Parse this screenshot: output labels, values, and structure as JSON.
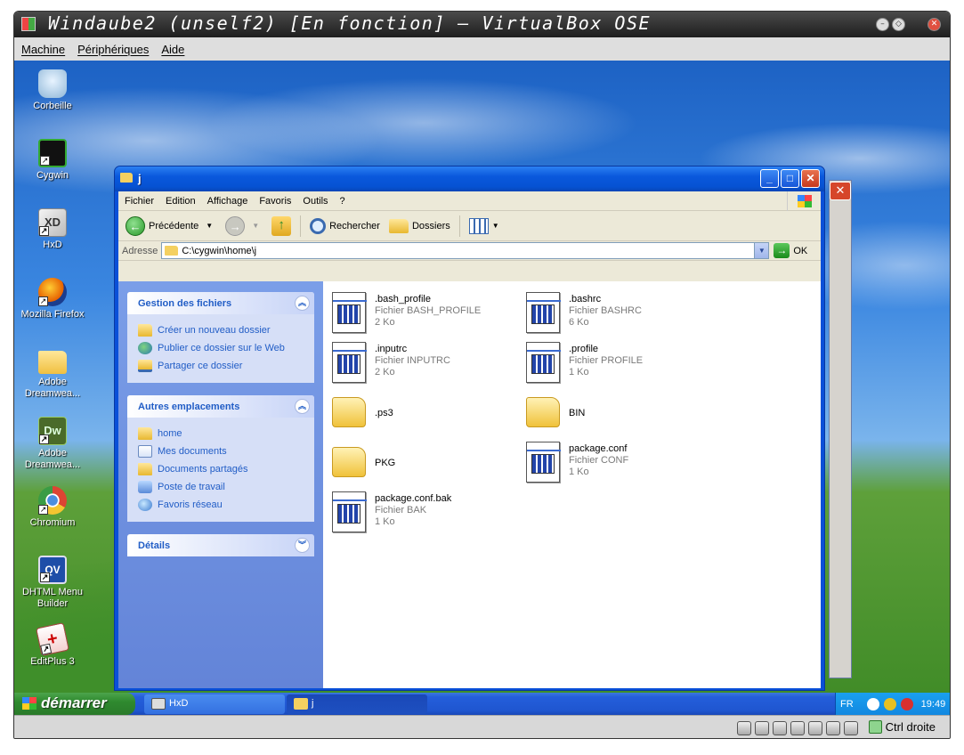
{
  "vbox": {
    "title": "Windaube2 (unself2) [En fonction] — VirtualBox OSE",
    "menu": [
      "Machine",
      "Périphériques",
      "Aide"
    ],
    "host_key": "Ctrl droite"
  },
  "desktop": {
    "icons": [
      {
        "label": "Corbeille",
        "icon": "recycle-bin-icon",
        "shortcut": false
      },
      {
        "label": "Cygwin",
        "icon": "cygwin-icon",
        "shortcut": true
      },
      {
        "label": "HxD",
        "icon": "hxd-icon",
        "shortcut": true
      },
      {
        "label": "Mozilla Firefox",
        "icon": "firefox-icon",
        "shortcut": true
      },
      {
        "label": "Adobe Dreamwea...",
        "icon": "folder-icon",
        "shortcut": false
      },
      {
        "label": "Adobe Dreamwea...",
        "icon": "dreamweaver-icon",
        "shortcut": true
      },
      {
        "label": "Chromium",
        "icon": "chromium-icon",
        "shortcut": true
      },
      {
        "label": "DHTML Menu Builder",
        "icon": "dhtml-menu-builder-icon",
        "shortcut": true
      },
      {
        "label": "EditPlus 3",
        "icon": "editplus-icon",
        "shortcut": true
      }
    ]
  },
  "explorer": {
    "title": "j",
    "menu": [
      "Fichier",
      "Edition",
      "Affichage",
      "Favoris",
      "Outils",
      "?"
    ],
    "toolbar": {
      "back": "Précédente",
      "search": "Rechercher",
      "folders": "Dossiers"
    },
    "address": {
      "label": "Adresse",
      "value": "C:\\cygwin\\home\\j",
      "go": "OK"
    },
    "panels": [
      {
        "title": "Gestion des fichiers",
        "items": [
          {
            "label": "Créer un nouveau dossier",
            "icon": "new-folder-icon"
          },
          {
            "label": "Publier ce dossier sur le Web",
            "icon": "publish-web-icon"
          },
          {
            "label": "Partager ce dossier",
            "icon": "share-folder-icon"
          }
        ]
      },
      {
        "title": "Autres emplacements",
        "items": [
          {
            "label": "home",
            "icon": "folder-icon"
          },
          {
            "label": "Mes documents",
            "icon": "my-documents-icon"
          },
          {
            "label": "Documents partagés",
            "icon": "shared-documents-icon"
          },
          {
            "label": "Poste de travail",
            "icon": "my-computer-icon"
          },
          {
            "label": "Favoris réseau",
            "icon": "network-places-icon"
          }
        ]
      },
      {
        "title": "Détails",
        "items": []
      }
    ],
    "files": [
      {
        "name": ".bash_profile",
        "type": "Fichier BASH_PROFILE",
        "size": "2 Ko",
        "kind": "doc"
      },
      {
        "name": ".bashrc",
        "type": "Fichier BASHRC",
        "size": "6 Ko",
        "kind": "doc"
      },
      {
        "name": ".inputrc",
        "type": "Fichier INPUTRC",
        "size": "2 Ko",
        "kind": "doc"
      },
      {
        "name": ".profile",
        "type": "Fichier PROFILE",
        "size": "1 Ko",
        "kind": "doc"
      },
      {
        "name": ".ps3",
        "type": "",
        "size": "",
        "kind": "folder"
      },
      {
        "name": "BIN",
        "type": "",
        "size": "",
        "kind": "folder"
      },
      {
        "name": "PKG",
        "type": "",
        "size": "",
        "kind": "folder"
      },
      {
        "name": "package.conf",
        "type": "Fichier CONF",
        "size": "1 Ko",
        "kind": "doc"
      },
      {
        "name": "package.conf.bak",
        "type": "Fichier BAK",
        "size": "1 Ko",
        "kind": "doc"
      }
    ]
  },
  "taskbar": {
    "start": "démarrer",
    "buttons": [
      {
        "label": "HxD",
        "active": false
      },
      {
        "label": "j",
        "active": true
      }
    ],
    "lang": "FR",
    "clock": "19:49"
  }
}
